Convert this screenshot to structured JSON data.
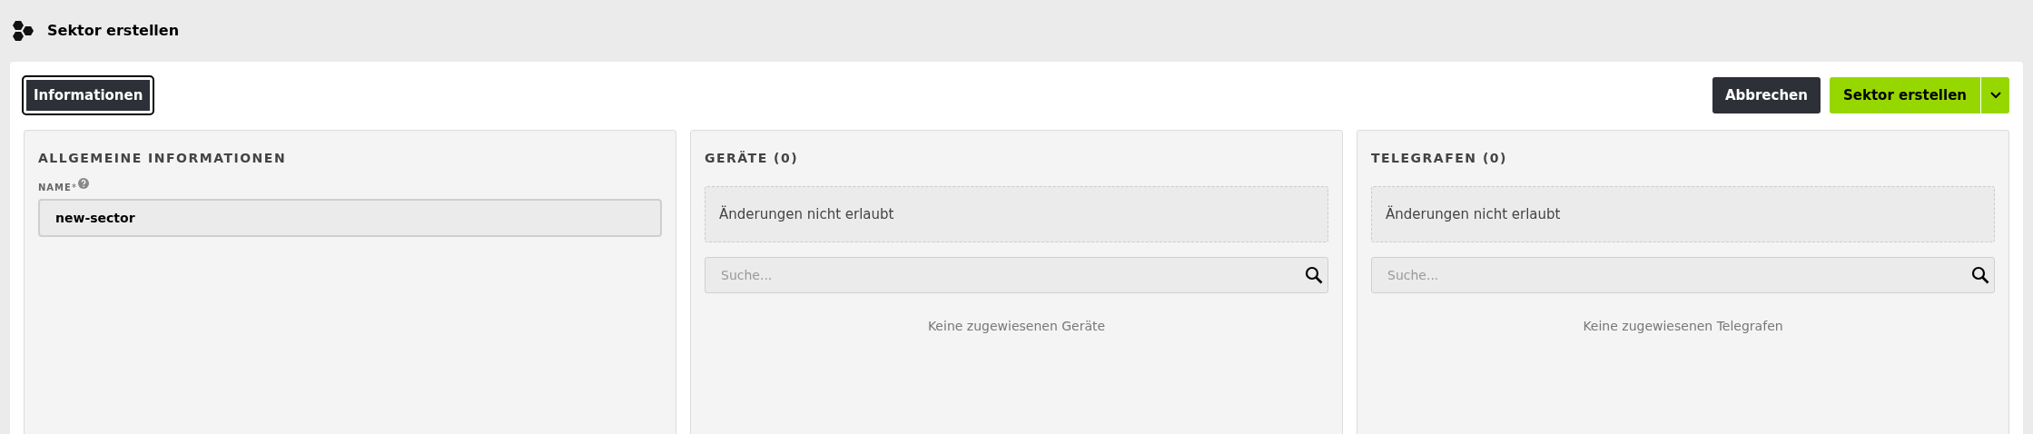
{
  "page": {
    "title": "Sektor erstellen"
  },
  "tabs": [
    {
      "label": "Informationen",
      "selected": true
    }
  ],
  "actions": {
    "cancel": "Abbrechen",
    "create": "Sektor erstellen"
  },
  "general": {
    "heading": "ALLGEMEINE INFORMATIONEN",
    "field_label": "NAME",
    "required_mark": "*",
    "value": "new-sector"
  },
  "lists": [
    {
      "heading": "GERÄTE (0)",
      "notice": "Änderungen nicht erlaubt",
      "search_placeholder": "Suche...",
      "empty_text": "Keine zugewiesenen Geräte"
    },
    {
      "heading": "TELEGRAFEN (0)",
      "notice": "Änderungen nicht erlaubt",
      "search_placeholder": "Suche...",
      "empty_text": "Keine zugewiesenen Telegrafen"
    }
  ]
}
